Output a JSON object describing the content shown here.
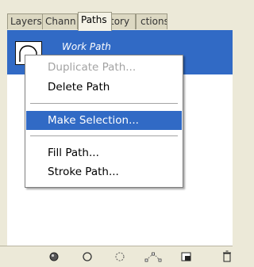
{
  "tabs": [
    {
      "label": "Layers"
    },
    {
      "label": "Chann"
    },
    {
      "label": "Paths"
    },
    {
      "label": "tory"
    },
    {
      "label": "ctions"
    }
  ],
  "path_item": {
    "name": "Work Path"
  },
  "context_menu": {
    "items": [
      {
        "label": "Duplicate Path...",
        "state": "disabled"
      },
      {
        "label": "Delete Path",
        "state": "enabled"
      },
      {
        "label": "Make Selection...",
        "state": "highlighted"
      },
      {
        "label": "Fill Path...",
        "state": "enabled"
      },
      {
        "label": "Stroke Path...",
        "state": "enabled"
      }
    ]
  },
  "bottom_buttons": [
    {
      "icon": "fill-path-icon"
    },
    {
      "icon": "stroke-path-icon"
    },
    {
      "icon": "load-as-selection-icon"
    },
    {
      "icon": "make-work-path-icon"
    },
    {
      "icon": "new-path-icon"
    },
    {
      "icon": "trash-icon"
    }
  ],
  "colors": {
    "panel_bg": "#ece9d8",
    "selection": "#316ac5",
    "disabled_text": "#a3a3a3"
  }
}
